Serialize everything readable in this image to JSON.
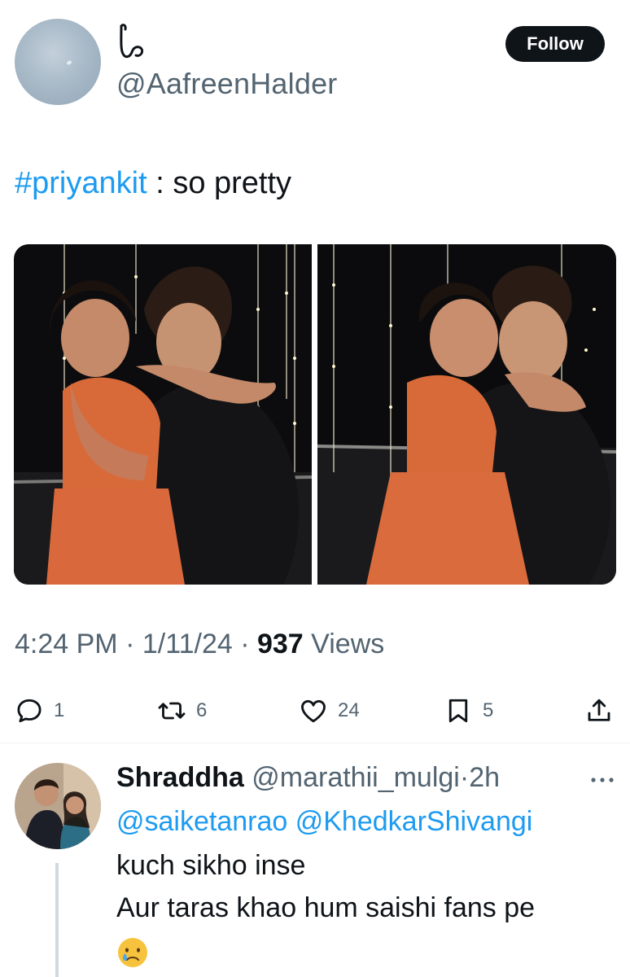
{
  "author": {
    "handle": "@AafreenHalder",
    "follow_label": "Follow"
  },
  "tweet": {
    "hashtag": "#priyankit",
    "text": " : so pretty",
    "time": "4:24 PM",
    "sep1": " · ",
    "date": "1/11/24",
    "sep2": " · ",
    "views_count": "937",
    "views_label": " Views"
  },
  "actions": {
    "reply_count": "1",
    "repost_count": "6",
    "like_count": "24",
    "bookmark_count": "5"
  },
  "reply": {
    "name": "Shraddha",
    "handle": " @marathii_mulgi",
    "sep": "·",
    "time": "2h",
    "mention1": "@saiketanrao",
    "mention2": " @KhedkarShivangi",
    "line1": "kuch sikho inse",
    "line2": "Aur taras khao hum saishi fans pe"
  },
  "icons": {
    "reply": "reply-icon",
    "repost": "repost-icon",
    "like": "heart-icon",
    "bookmark": "bookmark-icon",
    "share": "share-icon",
    "more": "more-icon",
    "emoji": "crying-face-emoji"
  },
  "colors": {
    "link": "#1d9bf0",
    "secondary_text": "#536471",
    "follow_bg": "#0f1419"
  }
}
